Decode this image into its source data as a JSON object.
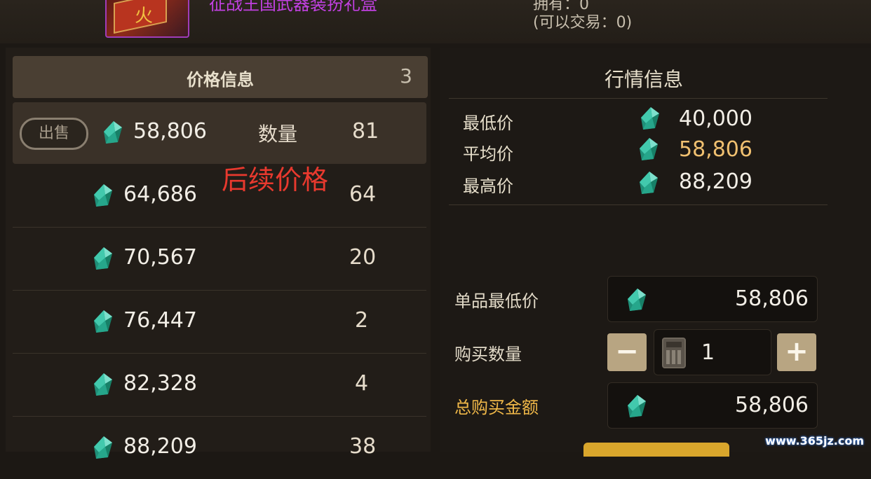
{
  "item": {
    "name": "征战王国武器装扮礼盒"
  },
  "ownership": {
    "owned": "拥有：0",
    "tradable": "(可以交易：0)"
  },
  "price_panel": {
    "title": "价格信息",
    "count": "3",
    "sell_label": "出售",
    "quantity_label": "数量",
    "annotation": "后续价格",
    "listings": [
      {
        "price": "58,806",
        "qty": "81"
      },
      {
        "price": "64,686",
        "qty": "64"
      },
      {
        "price": "70,567",
        "qty": "20"
      },
      {
        "price": "76,447",
        "qty": "2"
      },
      {
        "price": "82,328",
        "qty": "4"
      },
      {
        "price": "88,209",
        "qty": "38"
      }
    ]
  },
  "market_panel": {
    "title": "行情信息",
    "lowest_label": "最低价",
    "lowest_value": "40,000",
    "average_label": "平均价",
    "average_value": "58,806",
    "highest_label": "最高价",
    "highest_value": "88,209"
  },
  "buy_panel": {
    "unit_min_label": "单品最低价",
    "unit_min_value": "58,806",
    "quantity_label": "购买数量",
    "quantity_value": "1",
    "minus": "−",
    "plus": "+",
    "total_label": "总购买金额",
    "total_value": "58,806"
  },
  "watermark": "www.365jz.com",
  "colors": {
    "gem": "#2fb59a",
    "accent_gold": "#f0b848",
    "item_name": "#c040e0",
    "annotation": "#e8392e"
  }
}
